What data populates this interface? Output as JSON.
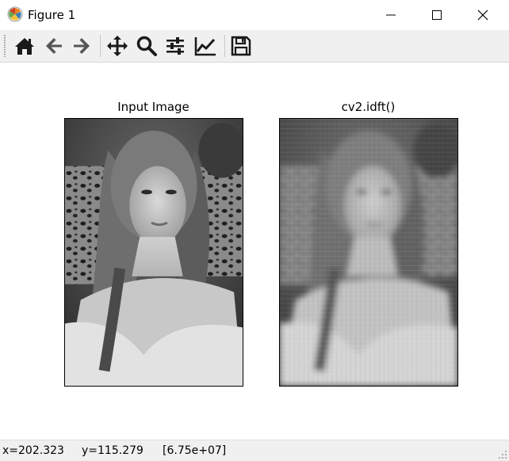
{
  "window": {
    "title": "Figure 1",
    "controls": [
      "minimize-icon",
      "maximize-icon",
      "close-icon"
    ]
  },
  "toolbar": {
    "tools": [
      {
        "name": "home",
        "icon": "home-icon"
      },
      {
        "name": "back",
        "icon": "arrow-left-icon"
      },
      {
        "name": "forward",
        "icon": "arrow-right-icon"
      },
      {
        "name": "pan",
        "icon": "move-icon"
      },
      {
        "name": "zoom",
        "icon": "magnifier-icon"
      },
      {
        "name": "subplots",
        "icon": "sliders-icon"
      },
      {
        "name": "customize",
        "icon": "chart-line-icon"
      },
      {
        "name": "save",
        "icon": "floppy-disk-icon"
      }
    ]
  },
  "figure": {
    "axes": [
      {
        "title": "Input Image",
        "content": "grayscale photograph (sharp)"
      },
      {
        "title": "cv2.idft()",
        "content": "grayscale photograph (blurred, low-pass reconstruction)"
      }
    ]
  },
  "status": {
    "x": "x=202.323",
    "y": "y=115.279",
    "value": "[6.75e+07]"
  },
  "colors": {
    "toolbar_bg": "#f0f0f0",
    "icon_color": "#1a1a1a",
    "canvas_bg": "#ffffff"
  }
}
